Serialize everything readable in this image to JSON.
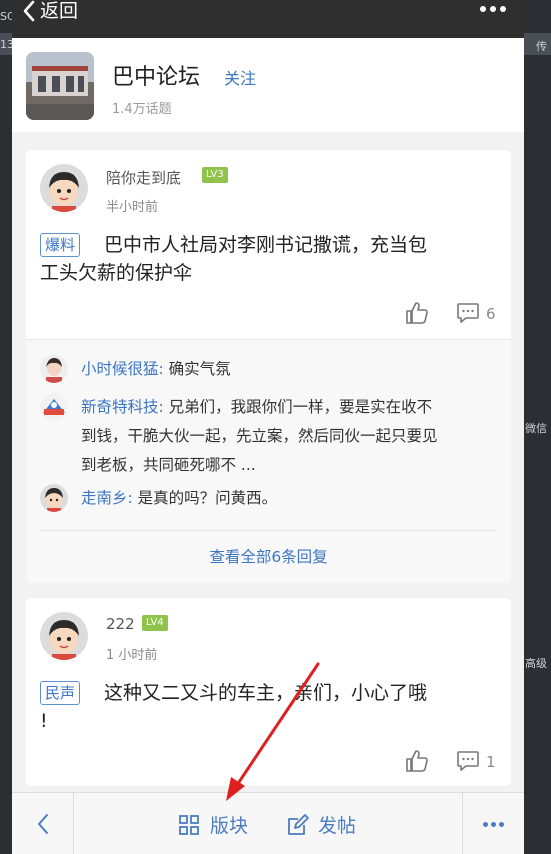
{
  "nav": {
    "back_label": "返回"
  },
  "forum": {
    "name": "巴中论坛",
    "follow_label": "关注",
    "topic_count": "1.4万话题"
  },
  "posts": [
    {
      "user": "陪你走到底",
      "level": "LV3",
      "time": "半小时前",
      "tag": "爆料",
      "title_line1": "巴中市人社局对李刚书记撒谎，充当包",
      "title_line2": "工头欠薪的保护伞",
      "comment_count": "6",
      "comments": [
        {
          "author": "小时候很猛:",
          "text": "确实气氛"
        },
        {
          "author": "新奇特科技:",
          "text": "兄弟们，我跟你们一样，要是实在收不",
          "line2": "到钱，干脆大伙一起，先立案，然后同伙一起只要见",
          "line3": "到老板，共同砸死哪不 ..."
        },
        {
          "author": "走南乡:",
          "text": "是真的吗？问黄西。"
        }
      ],
      "view_all": "查看全部6条回复"
    },
    {
      "user": "222",
      "level": "LV4",
      "time": "1 小时前",
      "tag": "民声",
      "title_line1": "这种又二又斗的车主，亲们，小心了哦",
      "title_line2": "!",
      "comment_count": "1"
    }
  ],
  "bottom_bar": {
    "board_label": "版块",
    "post_label": "发帖"
  },
  "background": {
    "left_text_1": "SC",
    "left_text_2": "13",
    "right_text_1": "传",
    "right_text_2": "微信",
    "right_text_3": "高级"
  },
  "colors": {
    "accent": "#3d77c3",
    "level_badge": "#8fc34b",
    "arrow": "#e0201e"
  }
}
